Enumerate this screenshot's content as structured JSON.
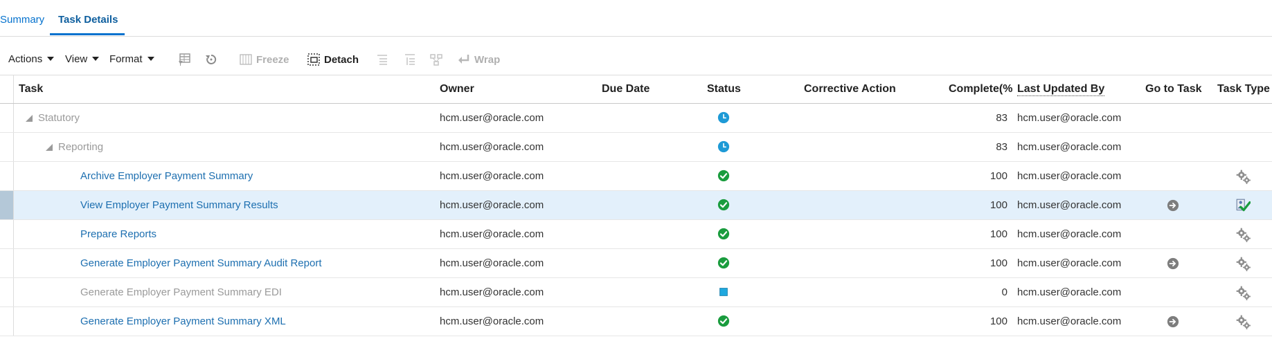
{
  "tabs": [
    {
      "label": "Summary"
    },
    {
      "label": "Task Details"
    }
  ],
  "toolbar": {
    "actions": "Actions",
    "view": "View",
    "format": "Format",
    "freeze": "Freeze",
    "detach": "Detach",
    "wrap": "Wrap"
  },
  "columns": {
    "task": "Task",
    "owner": "Owner",
    "due_date": "Due Date",
    "status": "Status",
    "corrective_action": "Corrective Action",
    "complete": "Complete(%",
    "last_updated_by": "Last Updated By",
    "go_to_task": "Go to Task",
    "task_type": "Task Type"
  },
  "rows": [
    {
      "task": "Statutory",
      "level": 0,
      "style": "grey",
      "expandable": true,
      "owner": "hcm.user@oracle.com",
      "status": "in-progress-clock-icon",
      "complete": "83",
      "updated_by": "hcm.user@oracle.com",
      "goto": false,
      "type": "none"
    },
    {
      "task": "Reporting",
      "level": 1,
      "style": "grey",
      "expandable": true,
      "owner": "hcm.user@oracle.com",
      "status": "in-progress-clock-icon",
      "complete": "83",
      "updated_by": "hcm.user@oracle.com",
      "goto": false,
      "type": "none"
    },
    {
      "task": "Archive Employer Payment Summary",
      "level": 2,
      "style": "link",
      "expandable": false,
      "owner": "hcm.user@oracle.com",
      "status": "completed-check-icon",
      "complete": "100",
      "updated_by": "hcm.user@oracle.com",
      "goto": false,
      "type": "gears-icon"
    },
    {
      "task": "View Employer Payment Summary Results",
      "level": 2,
      "style": "link",
      "expandable": false,
      "owner": "hcm.user@oracle.com",
      "status": "completed-check-icon",
      "complete": "100",
      "updated_by": "hcm.user@oracle.com",
      "goto": true,
      "type": "manual-check-icon",
      "selected": true
    },
    {
      "task": "Prepare Reports",
      "level": 2,
      "style": "link",
      "expandable": false,
      "owner": "hcm.user@oracle.com",
      "status": "completed-check-icon",
      "complete": "100",
      "updated_by": "hcm.user@oracle.com",
      "goto": false,
      "type": "gears-icon"
    },
    {
      "task": "Generate Employer Payment Summary Audit Report",
      "level": 2,
      "style": "link",
      "expandable": false,
      "owner": "hcm.user@oracle.com",
      "status": "completed-check-icon",
      "complete": "100",
      "updated_by": "hcm.user@oracle.com",
      "goto": true,
      "type": "gears-icon"
    },
    {
      "task": "Generate Employer Payment Summary EDI",
      "level": 2,
      "style": "grey",
      "expandable": false,
      "owner": "hcm.user@oracle.com",
      "status": "not-started-square-icon",
      "complete": "0",
      "updated_by": "hcm.user@oracle.com",
      "goto": false,
      "type": "gears-icon"
    },
    {
      "task": "Generate Employer Payment Summary XML",
      "level": 2,
      "style": "link",
      "expandable": false,
      "owner": "hcm.user@oracle.com",
      "status": "completed-check-icon",
      "complete": "100",
      "updated_by": "hcm.user@oracle.com",
      "goto": true,
      "type": "gears-icon"
    }
  ],
  "colors": {
    "link": "#1d6fb0",
    "tab_active": "#0572ce",
    "status_complete": "#1a9c3e",
    "status_progress": "#1e9ad6",
    "selected_row": "#e3f0fb"
  }
}
